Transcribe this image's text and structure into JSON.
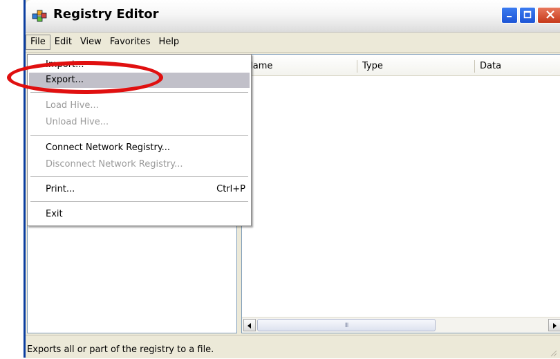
{
  "window": {
    "title": "Registry Editor"
  },
  "menubar": {
    "items": [
      {
        "label": "File",
        "active": true
      },
      {
        "label": "Edit"
      },
      {
        "label": "View"
      },
      {
        "label": "Favorites"
      },
      {
        "label": "Help"
      }
    ]
  },
  "file_menu": {
    "items": [
      {
        "label": "Import...",
        "enabled": true
      },
      {
        "label": "Export...",
        "enabled": true,
        "highlighted": true
      },
      {
        "label": "Load Hive...",
        "enabled": false
      },
      {
        "label": "Unload Hive...",
        "enabled": false
      },
      {
        "label": "Connect Network Registry...",
        "enabled": true
      },
      {
        "label": "Disconnect Network Registry...",
        "enabled": false
      },
      {
        "label": "Print...",
        "enabled": true,
        "shortcut": "Ctrl+P"
      },
      {
        "label": "Exit",
        "enabled": true
      }
    ]
  },
  "list": {
    "columns": [
      "Name",
      "Type",
      "Data"
    ],
    "scroll_grip": "III"
  },
  "statusbar": {
    "text": "Exports all or part of the registry to a file."
  },
  "colors": {
    "annotation": "#e01010",
    "menu_highlight": "#c1c0c9",
    "close_button": "#c6391a",
    "title_buttons": "#1e55d6"
  }
}
